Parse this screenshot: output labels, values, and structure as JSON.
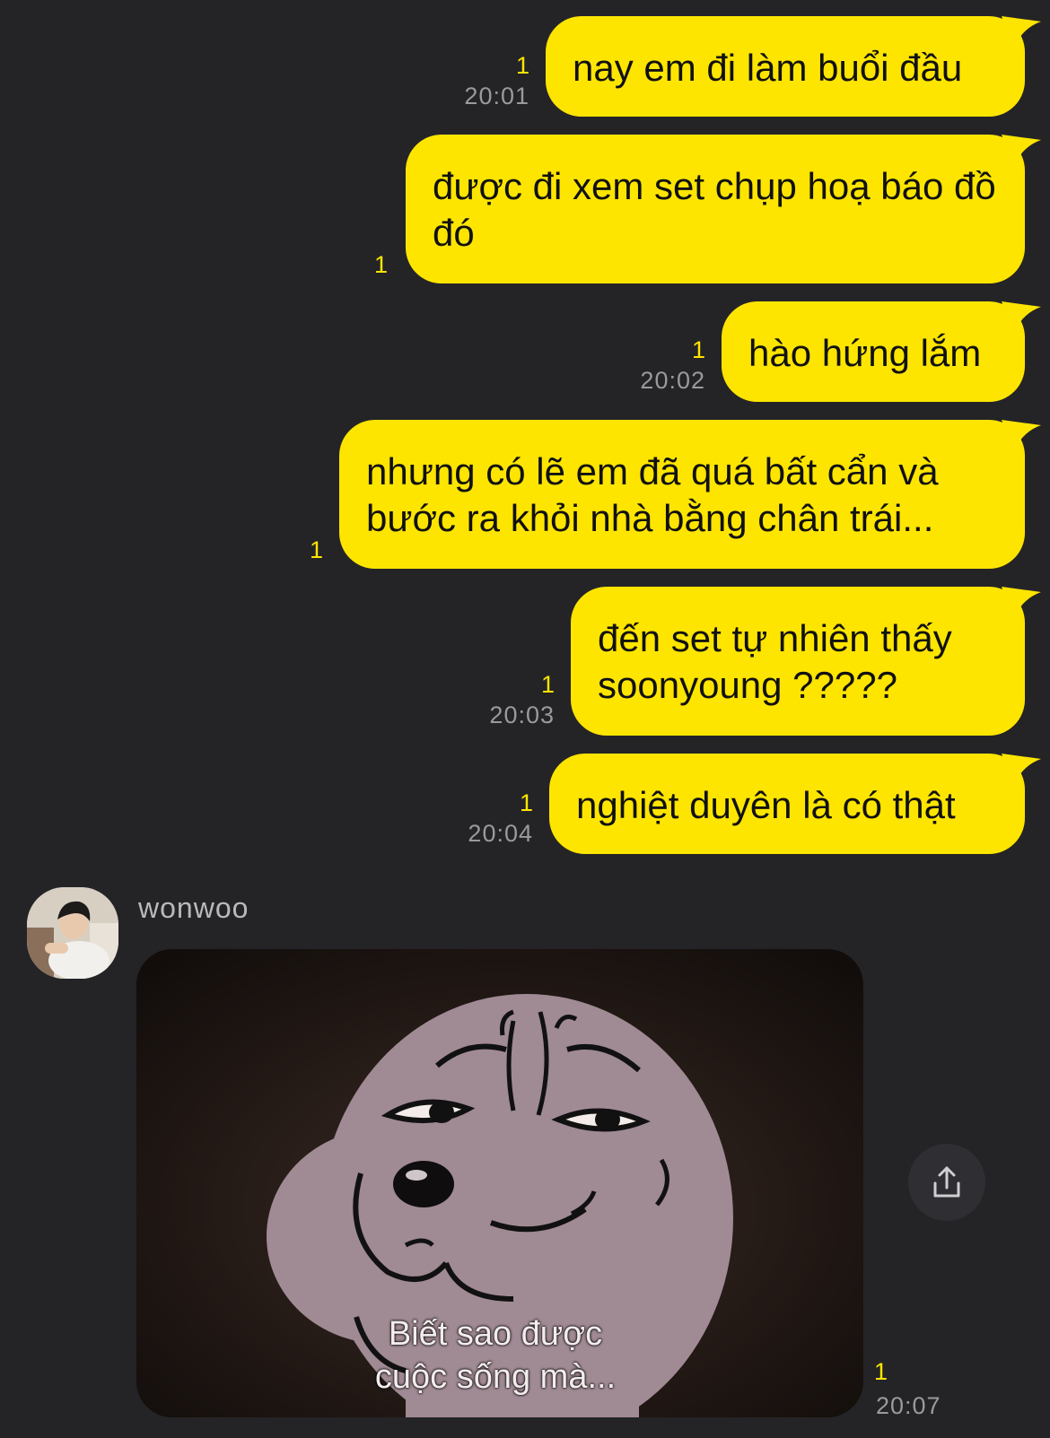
{
  "messages": [
    {
      "text": "nay em đi làm buổi đầu",
      "unread": "1",
      "time": "20:01"
    },
    {
      "text": "được đi xem set chụp hoạ báo đồ đó",
      "unread": "1",
      "time": ""
    },
    {
      "text": "hào hứng lắm",
      "unread": "1",
      "time": "20:02"
    },
    {
      "text": "nhưng có lẽ em đã quá bất cẩn và bước ra khỏi nhà bằng chân trái...",
      "unread": "1",
      "time": ""
    },
    {
      "text": "đến set tự nhiên thấy soonyoung ?????",
      "unread": "1",
      "time": "20:03"
    },
    {
      "text": "nghiệt duyên là có thật",
      "unread": "1",
      "time": "20:04"
    }
  ],
  "incoming": {
    "sender": "wonwoo",
    "image_caption_line1": "Biết sao được",
    "image_caption_line2": "cuộc sống mà...",
    "unread": "1",
    "time": "20:07"
  },
  "colors": {
    "background": "#242427",
    "bubble": "#FEE500",
    "unread": "#FEE500",
    "time": "#9a9a9e"
  },
  "icons": {
    "share": "share-icon",
    "avatar": "avatar"
  }
}
